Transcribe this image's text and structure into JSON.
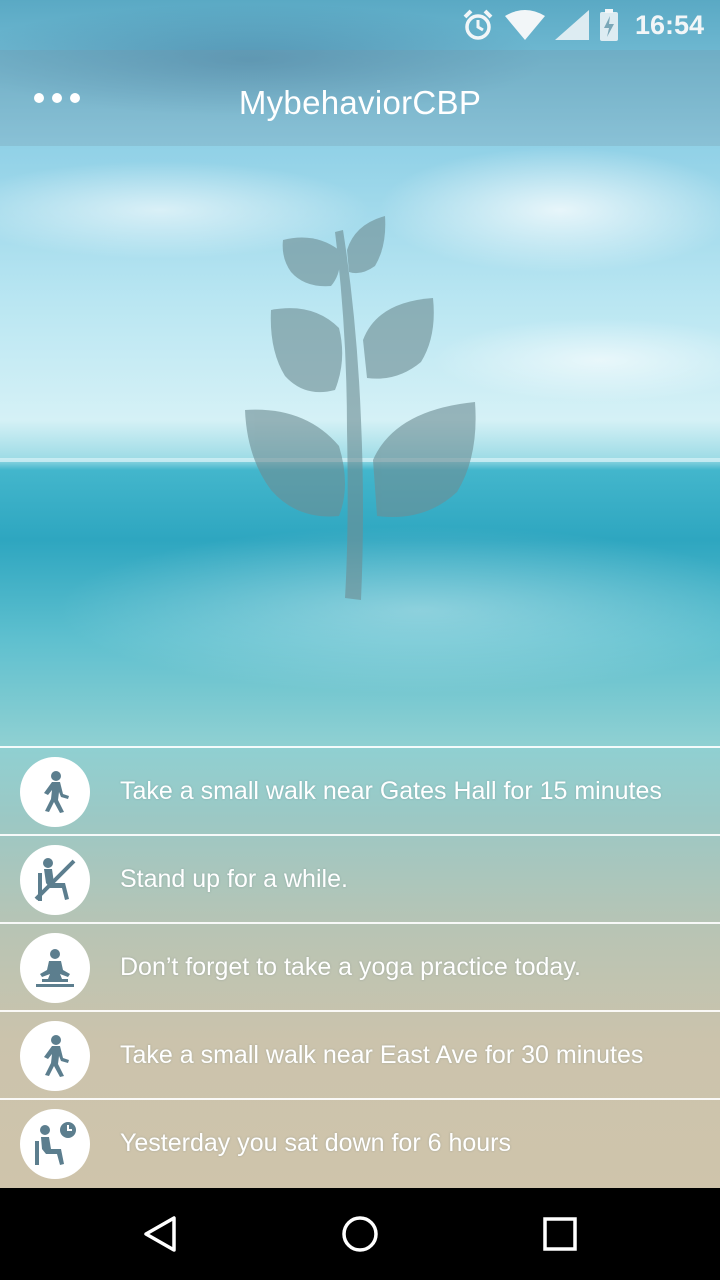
{
  "status_bar": {
    "time": "16:54",
    "icons": [
      "alarm-icon",
      "wifi-icon",
      "signal-icon",
      "battery-charging-icon"
    ]
  },
  "app_bar": {
    "title": "MybehaviorCBP",
    "menu_icon": "more-dots-icon"
  },
  "colors": {
    "list_text": "#ffffff",
    "icon_fill": "#5c7e8e",
    "logo_fill": "#6e8e94"
  },
  "suggestions": [
    {
      "icon": "walking-icon",
      "text": "Take a small walk near Gates Hall for 15 minutes"
    },
    {
      "icon": "no-sitting-icon",
      "text": "Stand up for a while."
    },
    {
      "icon": "yoga-icon",
      "text": "Don’t forget to take a yoga practice today."
    },
    {
      "icon": "walking-icon",
      "text": "Take a small walk near East Ave for 30 minutes"
    },
    {
      "icon": "sitting-clock-icon",
      "text": "Yesterday you sat down for 6 hours"
    }
  ],
  "nav_bar": {
    "back_icon": "back-triangle-icon",
    "home_icon": "home-circle-icon",
    "recents_icon": "recents-square-icon"
  }
}
